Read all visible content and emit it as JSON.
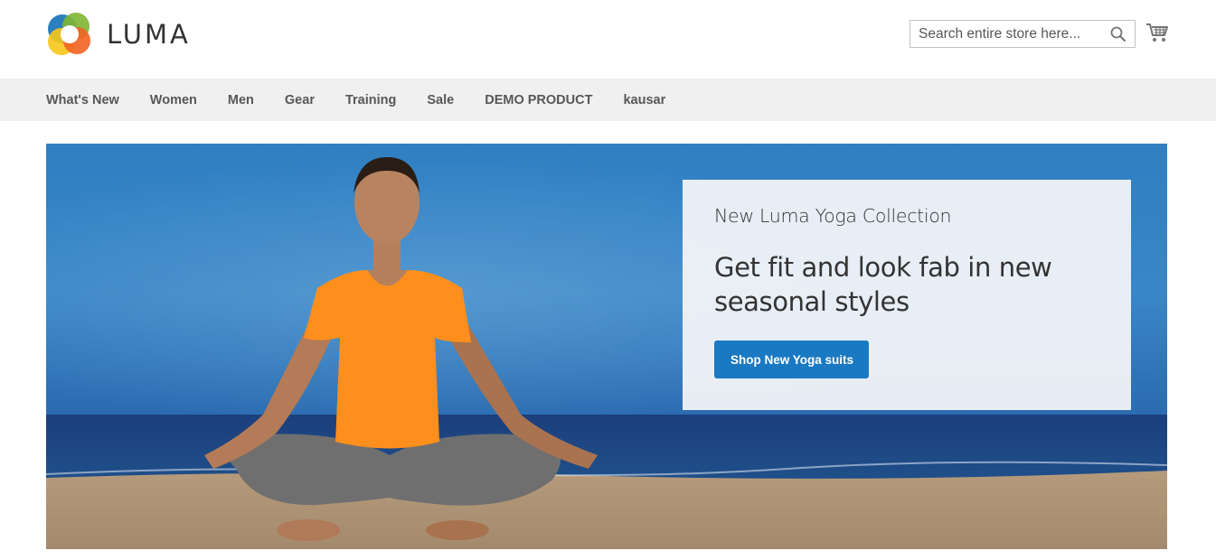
{
  "brand": {
    "name": "LUMA",
    "colors": {
      "green": "#7eb530",
      "blue": "#1a75b8",
      "orange": "#f26322",
      "yellow": "#f7c619"
    }
  },
  "search": {
    "placeholder": "Search entire store here...",
    "value": "",
    "icon": "search-icon"
  },
  "cart": {
    "icon": "shopping-cart-icon"
  },
  "nav": {
    "items": [
      "What's New",
      "Women",
      "Men",
      "Gear",
      "Training",
      "Sale",
      "DEMO PRODUCT",
      "kausar"
    ]
  },
  "hero": {
    "subtitle": "New Luma Yoga Collection",
    "title": "Get fit and look fab in new seasonal styles",
    "button_label": "Shop New Yoga suits",
    "accent_color": "#1979c3"
  }
}
